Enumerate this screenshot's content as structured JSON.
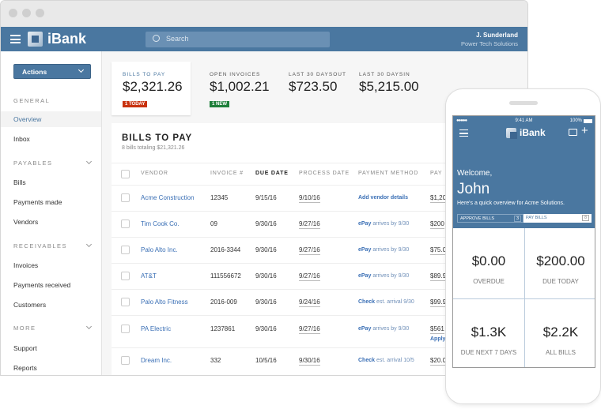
{
  "header": {
    "brand": "iBank",
    "search_placeholder": "Search",
    "user_name": "J. Sunderland",
    "company": "Power Tech Solutions"
  },
  "sidebar": {
    "actions_label": "Actions",
    "sections": [
      {
        "title": "GENERAL",
        "items": [
          "Overview",
          "Inbox"
        ]
      },
      {
        "title": "PAYABLES",
        "items": [
          "Bills",
          "Payments made",
          "Vendors"
        ]
      },
      {
        "title": "RECEIVABLES",
        "items": [
          "Invoices",
          "Payments received",
          "Customers"
        ]
      },
      {
        "title": "MORE",
        "items": [
          "Support",
          "Reports"
        ]
      }
    ],
    "active": "Overview"
  },
  "summary": [
    {
      "label": "BILLS TO PAY",
      "amount": "$2,321.26",
      "badge": "1 TODAY",
      "badge_color": "#c8320f"
    },
    {
      "label": "OPEN INVOICES",
      "amount": "$1,002.21",
      "badge": "1 NEW",
      "badge_color": "#1e7f3a"
    },
    {
      "label": "LAST 30 DAYSOUT",
      "amount": "$723.50"
    },
    {
      "label": "LAST 30 DAYSIN",
      "amount": "$5,215.00"
    }
  ],
  "bills": {
    "title": "BILLS TO PAY",
    "subtitle": "8 bills totaling $21,321.26",
    "columns": [
      "VENDOR",
      "INVOICE #",
      "DUE DATE",
      "PROCESS DATE",
      "PAYMENT METHOD",
      "PAY"
    ],
    "rows": [
      {
        "vendor": "Acme Construction",
        "invoice": "12345",
        "due": "9/15/16",
        "process": "9/10/16",
        "method": "Add vendor details",
        "note": "",
        "pay": "$1,20"
      },
      {
        "vendor": "Tim Cook Co.",
        "invoice": "09",
        "due": "9/30/16",
        "process": "9/27/16",
        "method": "ePay",
        "note": "arrives by 9/30",
        "pay": "$200"
      },
      {
        "vendor": "Palo Alto Inc.",
        "invoice": "2016-3344",
        "due": "9/30/16",
        "process": "9/27/16",
        "method": "ePay",
        "note": "arrives by 9/30",
        "pay": "$75.0"
      },
      {
        "vendor": "AT&T",
        "invoice": "111556672",
        "due": "9/30/16",
        "process": "9/27/16",
        "method": "ePay",
        "note": "arrives by 9/30",
        "pay": "$89.9"
      },
      {
        "vendor": "Palo Alto Fitness",
        "invoice": "2016-009",
        "due": "9/30/16",
        "process": "9/24/16",
        "method": "Check",
        "note": "est. arrival 9/30",
        "pay": "$99.9"
      },
      {
        "vendor": "PA Electric",
        "invoice": "1237861",
        "due": "9/30/16",
        "process": "9/27/16",
        "method": "ePay",
        "note": "arrives by 9/30",
        "pay": "$561",
        "extra": "Apply"
      },
      {
        "vendor": "Dream Inc.",
        "invoice": "332",
        "due": "10/5/16",
        "process": "9/30/16",
        "method": "Check",
        "note": "est. arrival 10/5",
        "pay": "$20.0"
      }
    ]
  },
  "phone": {
    "time": "9:41 AM",
    "battery": "100%",
    "brand": "iBank",
    "welcome": "Welcome,",
    "name": "John",
    "overview": "Here's a quick overview for Acme Solutions.",
    "tabs": [
      {
        "label": "APPROVE BILLS",
        "count": "3"
      },
      {
        "label": "PAY BILLS",
        "count": "8"
      }
    ],
    "tiles": [
      {
        "value": "$0.00",
        "label": "OVERDUE"
      },
      {
        "value": "$200.00",
        "label": "DUE TODAY"
      },
      {
        "value": "$1.3K",
        "label": "DUE NEXT 7 DAYS"
      },
      {
        "value": "$2.2K",
        "label": "ALL BILLS"
      }
    ]
  },
  "colors": {
    "brand": "#4a77a0",
    "link": "#3a6fb5"
  }
}
